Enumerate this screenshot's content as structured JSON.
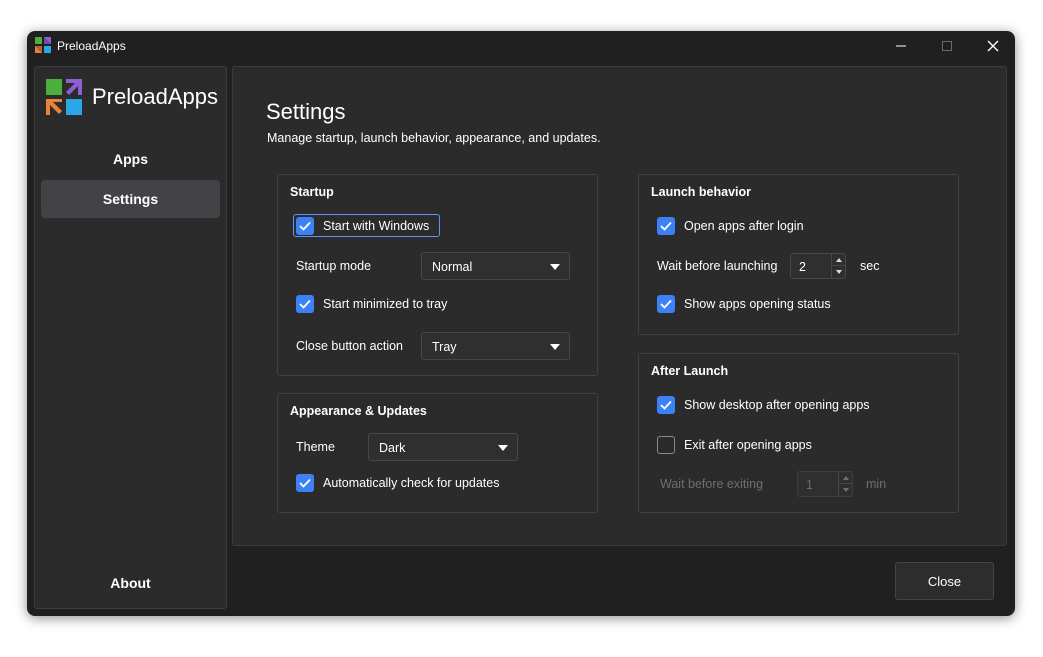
{
  "window": {
    "title": "PreloadApps",
    "controls": {
      "minimize": "minimize-icon",
      "maximize": "maximize-icon",
      "close": "close-icon"
    }
  },
  "brand": {
    "name": "PreloadApps",
    "logo_colors": {
      "green": "#4caf3d",
      "purple": "#8e5fd6",
      "orange": "#e8833a",
      "blue": "#2aa7e8"
    }
  },
  "sidebar": {
    "items": [
      {
        "label": "Apps",
        "active": false
      },
      {
        "label": "Settings",
        "active": true
      },
      {
        "label": "About",
        "active": false
      }
    ]
  },
  "page": {
    "title": "Settings",
    "subtitle": "Manage startup, launch behavior, appearance, and updates."
  },
  "startup": {
    "title": "Startup",
    "start_with_windows": {
      "label": "Start with Windows",
      "checked": true
    },
    "startup_mode": {
      "label": "Startup mode",
      "value": "Normal"
    },
    "start_minimized": {
      "label": "Start minimized to tray",
      "checked": true
    },
    "close_action": {
      "label": "Close button action",
      "value": "Tray"
    }
  },
  "appearance": {
    "title": "Appearance & Updates",
    "theme": {
      "label": "Theme",
      "value": "Dark"
    },
    "auto_update": {
      "label": "Automatically check for updates",
      "checked": true
    }
  },
  "launch": {
    "title": "Launch behavior",
    "open_after_login": {
      "label": "Open apps after login",
      "checked": true
    },
    "wait_before": {
      "label": "Wait before launching",
      "value": "2",
      "unit": "sec"
    },
    "show_status": {
      "label": "Show apps opening status",
      "checked": true
    }
  },
  "after_launch": {
    "title": "After Launch",
    "show_desktop": {
      "label": "Show desktop after opening apps",
      "checked": true
    },
    "exit_after": {
      "label": "Exit after opening apps",
      "checked": false
    },
    "wait_exit": {
      "label": "Wait before exiting",
      "value": "1",
      "unit": "min",
      "disabled": true
    }
  },
  "footer": {
    "close_label": "Close"
  },
  "colors": {
    "accent": "#3c82f6",
    "background": "#202020",
    "panel": "#2b2b2b"
  }
}
